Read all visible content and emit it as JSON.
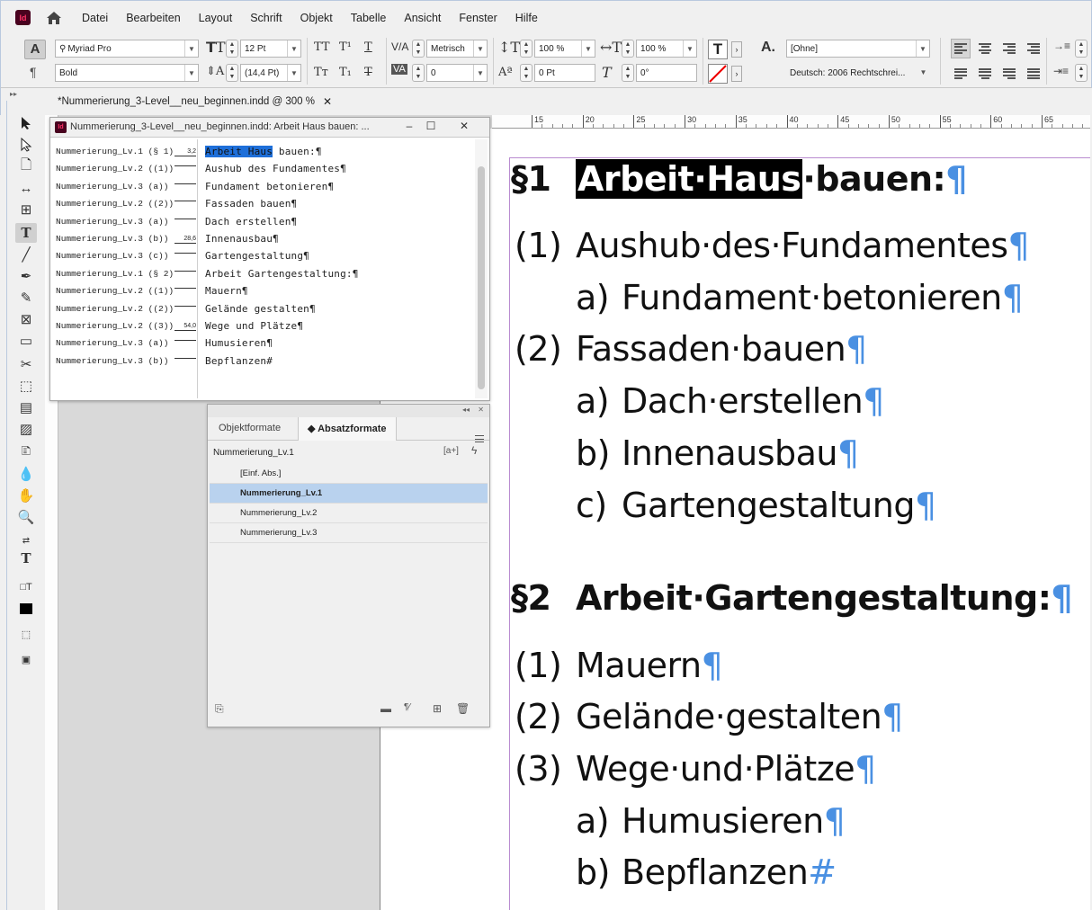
{
  "app": {
    "logo_text": "Id",
    "menu": [
      "Datei",
      "Bearbeiten",
      "Layout",
      "Schrift",
      "Objekt",
      "Tabelle",
      "Ansicht",
      "Fenster",
      "Hilfe"
    ]
  },
  "control_panel": {
    "font_family": "Myriad Pro",
    "font_style": "Bold",
    "font_size": "12 Pt",
    "leading": "(14,4 Pt)",
    "kerning": "Metrisch",
    "tracking": "0",
    "vertical_scale": "100 %",
    "horizontal_scale": "100 %",
    "baseline_shift": "0 Pt",
    "skew": "0°",
    "char_style": "[Ohne]",
    "language": "Deutsch: 2006 Rechtschrei..."
  },
  "document": {
    "tab_title": "*Nummerierung_3-Level__neu_beginnen.indd @ 300 %",
    "ruler_labels": [
      "15",
      "20",
      "25",
      "30",
      "35",
      "40",
      "45",
      "50",
      "55",
      "60",
      "65"
    ]
  },
  "story_editor": {
    "title": "Nummerierung_3-Level__neu_beginnen.indd: Arbeit Haus bauen: ...",
    "rows": [
      {
        "style": "Nummerierung_Lv.1 (§ 1)",
        "depth": "3,2",
        "text_sel": "Arbeit Haus",
        "text": " bauen:¶"
      },
      {
        "style": "Nummerierung_Lv.2 ((1))",
        "depth": "",
        "text_sel": "",
        "text": "Aushub des Fundamentes¶"
      },
      {
        "style": "Nummerierung_Lv.3 (a))",
        "depth": "",
        "text_sel": "",
        "text": "Fundament betonieren¶"
      },
      {
        "style": "Nummerierung_Lv.2 ((2))",
        "depth": "",
        "text_sel": "",
        "text": "Fassaden bauen¶"
      },
      {
        "style": "Nummerierung_Lv.3 (a))",
        "depth": "",
        "text_sel": "",
        "text": "Dach erstellen¶"
      },
      {
        "style": "Nummerierung_Lv.3 (b))",
        "depth": "28,6",
        "text_sel": "",
        "text": "Innenausbau¶"
      },
      {
        "style": "Nummerierung_Lv.3 (c))",
        "depth": "",
        "text_sel": "",
        "text": "Gartengestaltung¶"
      },
      {
        "style": "Nummerierung_Lv.1 (§ 2)",
        "depth": "",
        "text_sel": "",
        "text": "Arbeit Gartengestaltung:¶"
      },
      {
        "style": "Nummerierung_Lv.2 ((1))",
        "depth": "",
        "text_sel": "",
        "text": "Mauern¶"
      },
      {
        "style": "Nummerierung_Lv.2 ((2))",
        "depth": "",
        "text_sel": "",
        "text": "Gelände gestalten¶"
      },
      {
        "style": "Nummerierung_Lv.2 ((3))",
        "depth": "54,0",
        "text_sel": "",
        "text": "Wege und Plätze¶"
      },
      {
        "style": "Nummerierung_Lv.3 (a))",
        "depth": "",
        "text_sel": "",
        "text": "Humusieren¶"
      },
      {
        "style": "Nummerierung_Lv.3 (b))",
        "depth": "",
        "text_sel": "",
        "text": "Bepflanzen#"
      }
    ]
  },
  "paragraph_styles": {
    "tabs": [
      "Objektformate",
      "Absatzformate"
    ],
    "current": "Nummerierung_Lv.1",
    "items": [
      "[Einf. Abs.]",
      "Nummerierung_Lv.1",
      "Nummerierung_Lv.2",
      "Nummerierung_Lv.3"
    ],
    "active_item": "Nummerierung_Lv.1"
  },
  "page_content": {
    "paragraphs": [
      {
        "level": 1,
        "num": "§1",
        "sel": "Arbeit·Haus",
        "text": "·bauen:",
        "end": "¶"
      },
      {
        "level": 2,
        "num": "(1)",
        "text": "Aushub·des·Fundamentes",
        "end": "¶"
      },
      {
        "level": 3,
        "num": "a)",
        "text": "Fundament·betonieren",
        "end": "¶"
      },
      {
        "level": 2,
        "num": "(2)",
        "text": "Fassaden·bauen",
        "end": "¶"
      },
      {
        "level": 3,
        "num": "a)",
        "text": "Dach·erstellen",
        "end": "¶"
      },
      {
        "level": 3,
        "num": "b)",
        "text": "Innenausbau",
        "end": "¶"
      },
      {
        "level": 3,
        "num": "c)",
        "text": "Gartengestaltung",
        "end": "¶"
      },
      {
        "level": 1,
        "num": "§2",
        "sel": "",
        "text": "Arbeit·Gartengestaltung:",
        "end": "¶"
      },
      {
        "level": 2,
        "num": "(1)",
        "text": "Mauern",
        "end": "¶"
      },
      {
        "level": 2,
        "num": "(2)",
        "text": "Gelände·gestalten",
        "end": "¶"
      },
      {
        "level": 2,
        "num": "(3)",
        "text": "Wege·und·Plätze",
        "end": "¶"
      },
      {
        "level": 3,
        "num": "a)",
        "text": "Humusieren",
        "end": "¶"
      },
      {
        "level": 3,
        "num": "b)",
        "text": "Bepflanzen",
        "end": "#"
      }
    ]
  },
  "colors": {
    "accent": "#1e6fd9",
    "pilcrow": "#4a90e2",
    "selection_list": "#b9d2ee",
    "margin_guide": "#b98bd0"
  }
}
